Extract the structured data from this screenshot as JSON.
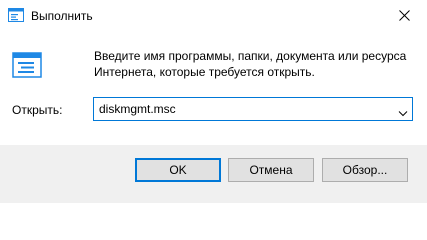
{
  "window": {
    "title": "Выполнить",
    "title_icon": "run-dialog-icon",
    "close_icon": "close-icon"
  },
  "main": {
    "icon": "run-program-icon",
    "description_lines": [
      "Введите имя программы, папки, документа или ресурса",
      "Интернета, которые требуется открыть."
    ],
    "open_label": "Открыть:",
    "open_value": "diskmgmt.msc",
    "dropdown_icon": "chevron-down-icon"
  },
  "buttons": {
    "ok_label": "OK",
    "cancel_label": "Отмена",
    "browse_label": "Обзор..."
  },
  "colors": {
    "accent": "#0078d7",
    "footer_bg": "#f0f0f0",
    "button_bg": "#e1e1e1",
    "button_border": "#adadad"
  }
}
